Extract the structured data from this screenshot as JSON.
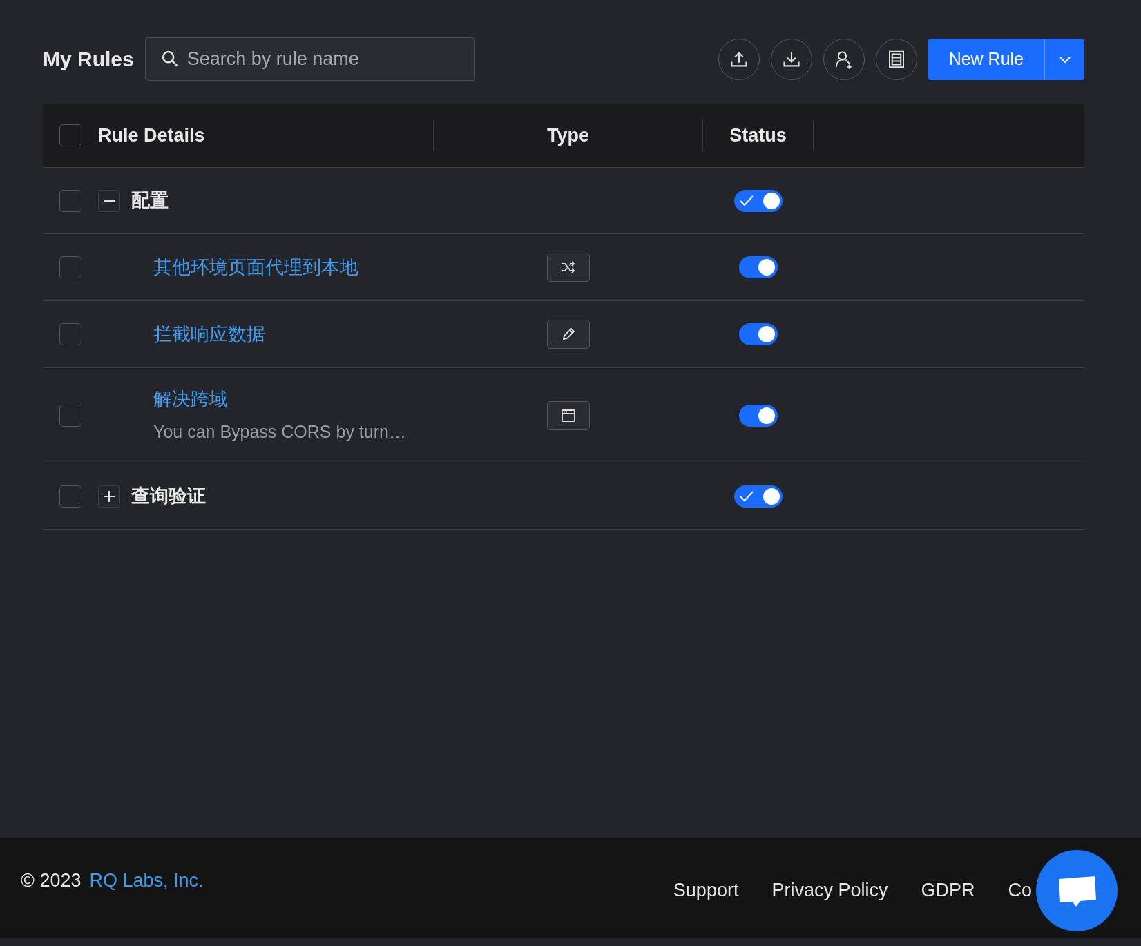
{
  "header": {
    "title": "My Rules",
    "search": {
      "placeholder": "Search by rule name"
    },
    "new_rule_button": "New Rule"
  },
  "table": {
    "select_all": {
      "checked": false
    },
    "columns": [
      "Rule Details",
      "Type",
      "Status"
    ],
    "groups": [
      {
        "name": "配置",
        "expanded": true,
        "checked": false,
        "on": true,
        "rules": [
          {
            "name": "其他环境页面代理到本地",
            "kind": "redirect",
            "checked": false,
            "on": true
          },
          {
            "name": "拦截响应数据",
            "kind": "response",
            "checked": false,
            "on": true
          },
          {
            "name": "解决跨域",
            "description": "You can Bypass CORS by turn…",
            "kind": "headers",
            "checked": false,
            "on": true
          }
        ]
      },
      {
        "name": "查询验证",
        "expanded": false,
        "checked": false,
        "on": true
      }
    ]
  },
  "footer": {
    "copyright": "© 2023",
    "company": "RQ Labs, Inc.",
    "links": [
      "Support",
      "Privacy Policy",
      "GDPR",
      "Co"
    ]
  }
}
